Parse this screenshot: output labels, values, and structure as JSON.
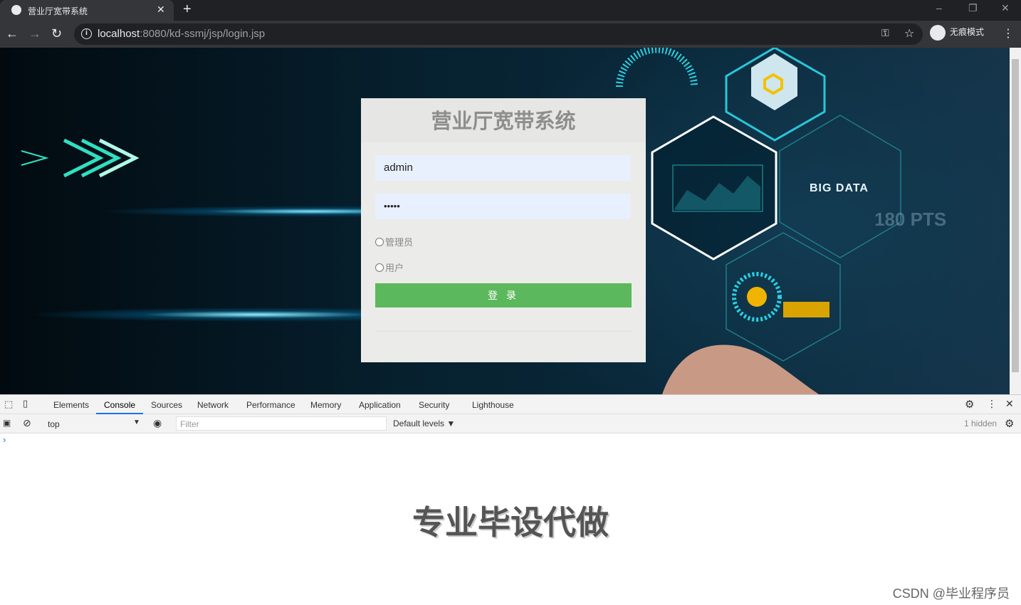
{
  "browser": {
    "tab_title": "营业厅宽带系统",
    "url_host": "localhost",
    "url_path": ":8080/kd-ssmj/jsp/login.jsp",
    "incognito_label": "无痕模式"
  },
  "background": {
    "big_data": "BIG DATA",
    "pts": "180 PTS"
  },
  "login": {
    "title": "营业厅宽带系统",
    "username": "admin",
    "password": "•••••",
    "roles": [
      "管理员",
      "用户"
    ],
    "submit": "登 录",
    "button_color": "#5cb85c"
  },
  "devtools": {
    "tabs": [
      "Elements",
      "Console",
      "Sources",
      "Network",
      "Performance",
      "Memory",
      "Application",
      "Security",
      "Lighthouse"
    ],
    "active_tab": "Console",
    "context": "top",
    "filter_placeholder": "Filter",
    "levels": "Default levels ▼",
    "hidden": "1 hidden",
    "prompt": "›"
  },
  "watermark": {
    "center": "专业毕设代做",
    "corner": "CSDN @毕业程序员"
  }
}
